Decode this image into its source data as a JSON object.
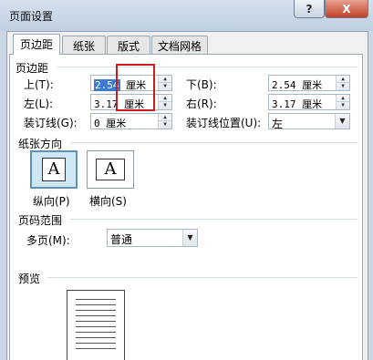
{
  "window": {
    "title": "页面设置",
    "help_button": "?",
    "close_button": "X"
  },
  "tabs": [
    {
      "label": "页边距",
      "active": true
    },
    {
      "label": "纸张",
      "active": false
    },
    {
      "label": "版式",
      "active": false
    },
    {
      "label": "文档网格",
      "active": false
    }
  ],
  "margins": {
    "section_title": "页边距",
    "top_label": "上(T):",
    "top_value": "2.54",
    "top_unit": "厘米",
    "bottom_label": "下(B):",
    "bottom_value": "2.54 厘米",
    "left_label": "左(L):",
    "left_value": "3.17",
    "left_unit": "厘米",
    "right_label": "右(R):",
    "right_value": "3.17 厘米",
    "gutter_label": "装订线(G):",
    "gutter_value": "0 厘米",
    "gutter_pos_label": "装订线位置(U):",
    "gutter_pos_value": "左"
  },
  "orientation": {
    "section_title": "纸张方向",
    "portrait_glyph": "A",
    "portrait_label": "纵向(P)",
    "landscape_glyph": "A",
    "landscape_label": "横向(S)",
    "selected": "portrait"
  },
  "pages": {
    "section_title": "页码范围",
    "multiple_label": "多页(M):",
    "multiple_value": "普通"
  },
  "preview": {
    "section_title": "预览"
  },
  "colors": {
    "highlight_box": "#c81e1e",
    "selection": "#3d7bd2"
  }
}
